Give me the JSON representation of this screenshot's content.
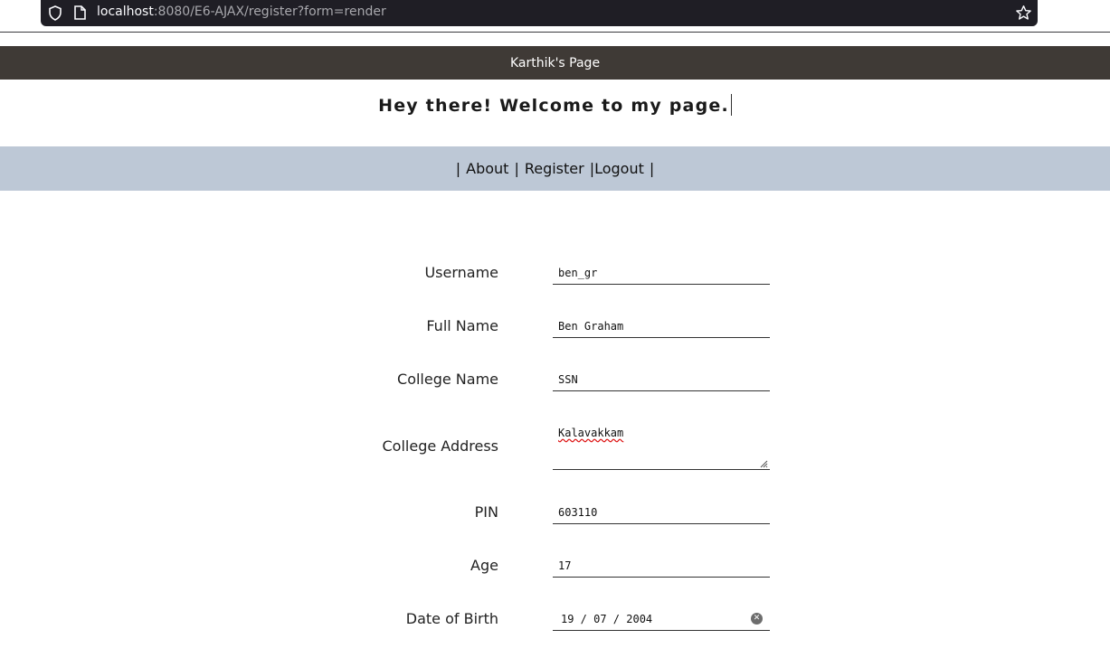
{
  "browser": {
    "url_host": "localhost",
    "url_rest": ":8080/E6-AJAX/register?form=render"
  },
  "icons": {
    "shield": "shield-icon",
    "page": "page-icon",
    "bookmark": "star-icon",
    "clear": "clear-x-icon"
  },
  "header": {
    "title": "Karthik's Page",
    "welcome": "Hey there! Welcome to my page."
  },
  "nav": {
    "separator": "|",
    "items": [
      {
        "label": "About"
      },
      {
        "label": "Register"
      },
      {
        "label": "Logout"
      }
    ]
  },
  "form": {
    "username": {
      "label": "Username",
      "value": "ben_gr"
    },
    "fullname": {
      "label": "Full Name",
      "value": "Ben Graham"
    },
    "college": {
      "label": "College Name",
      "value": "SSN"
    },
    "address": {
      "label": "College Address",
      "value": "Kalavakkam"
    },
    "pin": {
      "label": "PIN",
      "value": "603110"
    },
    "age": {
      "label": "Age",
      "value": "17"
    },
    "dob": {
      "label": "Date of Birth",
      "value": "19 / 07 / 2004"
    }
  },
  "colors": {
    "header_bg": "#3f3a36",
    "nav_bg": "#bdc8d6",
    "urlbar_bg": "#1f1e25"
  }
}
